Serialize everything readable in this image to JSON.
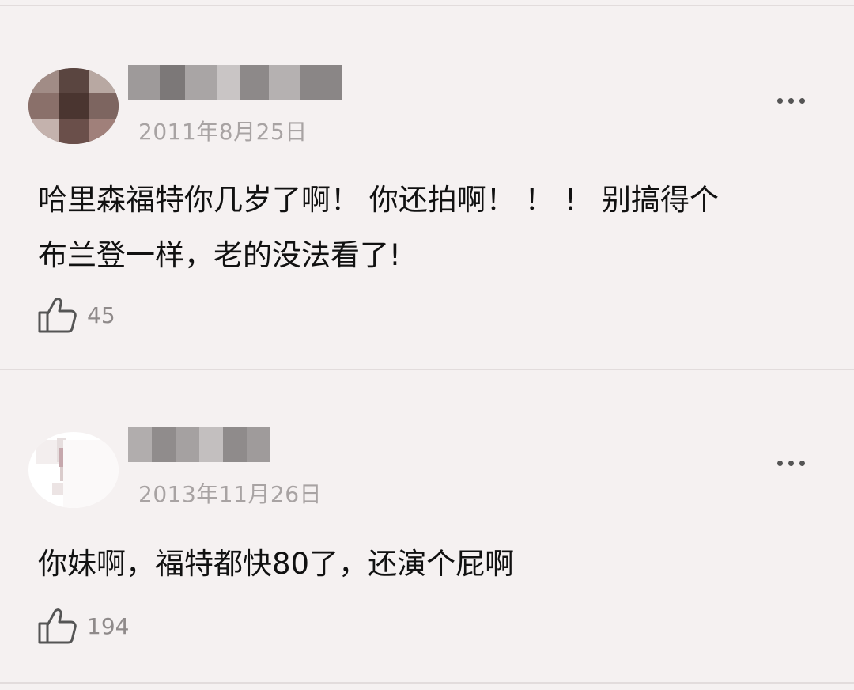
{
  "comments": [
    {
      "date": "2011年8月25日",
      "lines": [
        "哈里森福特你几岁了啊！ 你还拍啊！ ！ ！ 别搞得个",
        "布兰登一样，老的没法看了!"
      ],
      "likes": "45",
      "more_icon": "more-dots-icon",
      "like_icon": "thumbs-up-icon"
    },
    {
      "date": "2013年11月26日",
      "lines": [
        "你妹啊，福特都快80了，还演个屁啊"
      ],
      "likes": "194",
      "more_icon": "more-dots-icon",
      "like_icon": "thumbs-up-icon"
    }
  ],
  "colors": {
    "background": "#f5f1f1",
    "divider": "#e2dcdc",
    "text": "#111111",
    "meta_text": "#a8a3a3",
    "like_count": "#8f8a8a"
  }
}
